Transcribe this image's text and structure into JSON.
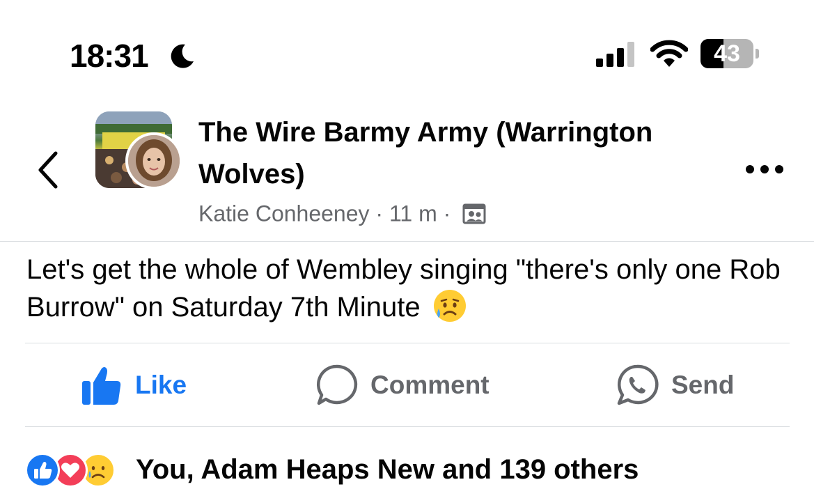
{
  "status_bar": {
    "time": "18:31",
    "battery_level": "43",
    "battery_fraction": 0.43,
    "icons": [
      "moon-icon",
      "cellular-signal-icon",
      "wifi-icon",
      "battery-icon"
    ]
  },
  "header": {
    "group_name": "The Wire Barmy Army (Warrington Wolves)",
    "author": "Katie Conheeney",
    "separator": "·",
    "time_ago": "11 m",
    "icons": [
      "back-chevron-icon",
      "group-audience-icon",
      "more-options-icon"
    ]
  },
  "post": {
    "text": "Let's get the whole of Wembley singing \"there's only one Rob Burrow\" on Saturday 7th Minute",
    "emoji": "sad-but-relieved-face"
  },
  "actions": {
    "like_label": "Like",
    "comment_label": "Comment",
    "send_label": "Send"
  },
  "reactions": {
    "types": [
      "like",
      "love",
      "sad"
    ],
    "summary": "You, Adam Heaps New and 139 others"
  },
  "colors": {
    "facebook_blue": "#1877f2",
    "secondary_text": "#65676b",
    "love_red": "#f33e58",
    "divider": "#dadde1"
  }
}
